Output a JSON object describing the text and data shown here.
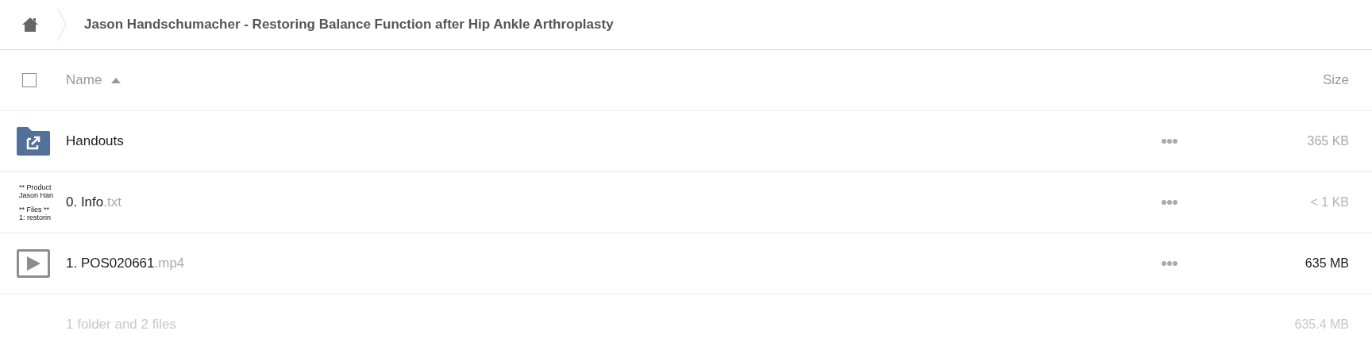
{
  "breadcrumb": {
    "title": "Jason Handschumacher - Restoring Balance Function after Hip Ankle Arthroplasty"
  },
  "table": {
    "select_all": {
      "checked": false
    },
    "columns": [
      {
        "label": "Name",
        "sorted_ascending": true
      },
      {
        "label": "Size"
      }
    ],
    "rows": [
      {
        "kind": "folder",
        "name": "Handouts",
        "size": "365 KB",
        "color": "#a8a8a8"
      },
      {
        "kind": "text",
        "preview_lines": [
          "** Product",
          "Jason Han",
          "** Files **",
          "1: restorin"
        ],
        "name": "0. Info",
        "extension": ".txt",
        "size": "< 1 KB",
        "color": "#b4b4b4"
      },
      {
        "kind": "video",
        "name": "1. POS020661",
        "extension": ".mp4",
        "size": "635 MB",
        "color": "#222222"
      }
    ],
    "summary": {
      "count": "1 folder and 2 files",
      "total": "635.4 MB"
    }
  }
}
